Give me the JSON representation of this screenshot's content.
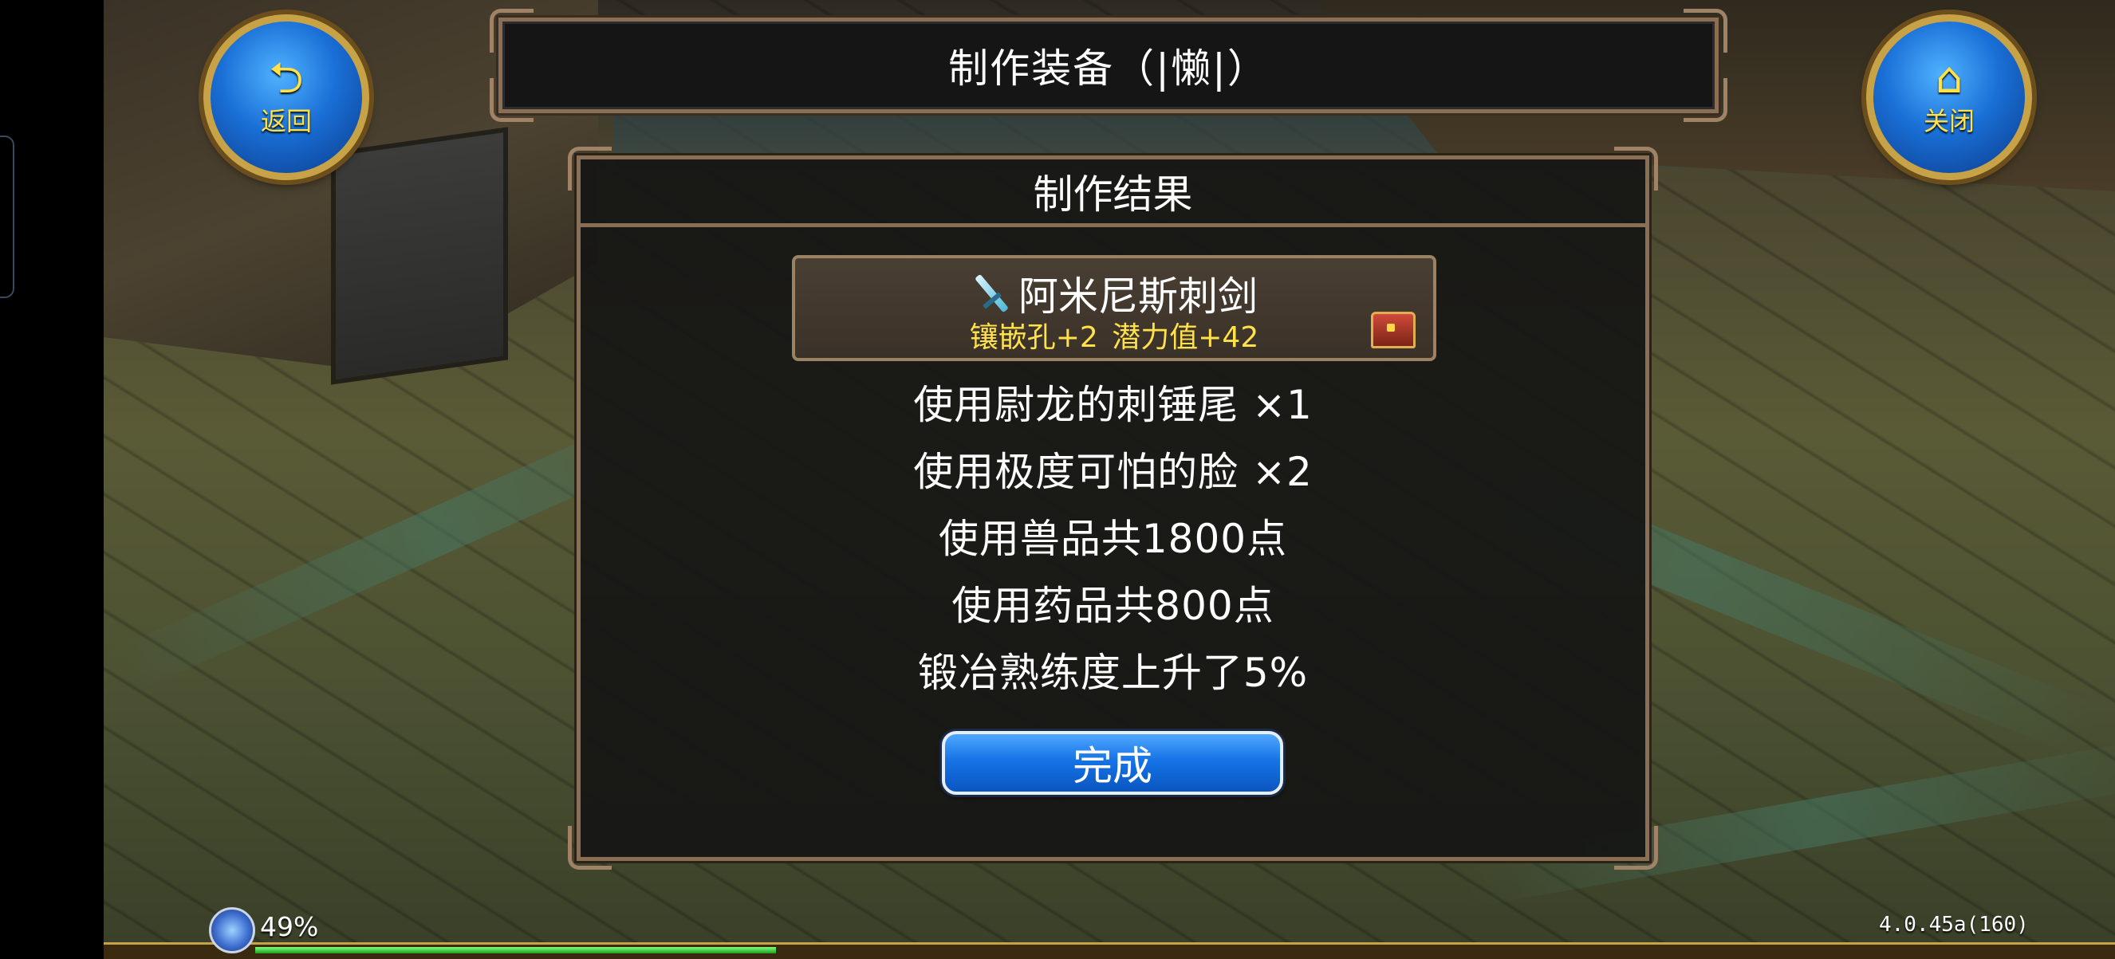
{
  "window": {
    "title": "制作装备（|懒|）"
  },
  "nav": {
    "back_label": "返回",
    "back_icon": "back-arrow-icon",
    "close_label": "关闭",
    "close_icon": "home-icon"
  },
  "panel": {
    "header": "制作结果",
    "item": {
      "name": "阿米尼斯刺剑",
      "stats": "镶嵌孔+2  潜力值+42",
      "icon": "sword-icon",
      "badge_icon": "treasure-chest-icon"
    },
    "lines": [
      "使用尉龙的刺锤尾 ×1",
      "使用极度可怕的脸 ×2",
      "使用兽品共1800点",
      "使用药品共800点",
      "锻冶熟练度上升了5%"
    ],
    "done_label": "完成"
  },
  "hud": {
    "battery": "49%",
    "version": "4.0.45a(160)",
    "progress_fraction": 0.28
  },
  "colors": {
    "accent_gold": "#c8a246",
    "stat_yellow": "#ffe14a",
    "button_blue": "#1673e6",
    "frame_brown": "#8a6f55"
  }
}
